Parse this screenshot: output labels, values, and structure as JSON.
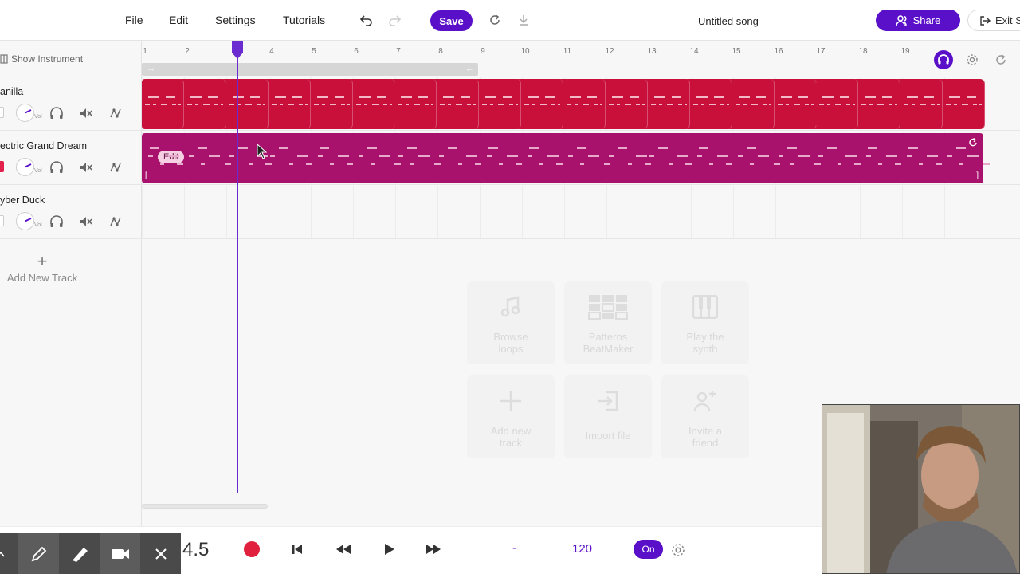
{
  "menu": {
    "file": "File",
    "edit": "Edit",
    "settings": "Settings",
    "tutorials": "Tutorials",
    "save": "Save"
  },
  "song_title": "Untitled song",
  "share_label": "Share",
  "exit_label": "Exit S",
  "left_panel": {
    "show_instrument": "Show Instrument",
    "add_new_track": "Add New Track",
    "vol_label": "Vol"
  },
  "tracks": [
    {
      "name": "anilla"
    },
    {
      "name": "ectric Grand Dream"
    },
    {
      "name": "yber Duck"
    }
  ],
  "ruler_ticks": [
    "1",
    "2",
    "4",
    "5",
    "6",
    "7",
    "8",
    "9",
    "10",
    "11",
    "12",
    "13",
    "14",
    "15",
    "16",
    "17",
    "18",
    "19"
  ],
  "clip_edit_label": "Edit",
  "tiles": [
    {
      "label1": "Browse",
      "label2": "loops"
    },
    {
      "label1": "Patterns",
      "label2": "BeatMaker"
    },
    {
      "label1": "Play the",
      "label2": "synth"
    },
    {
      "label1": "Add new",
      "label2": "track"
    },
    {
      "label1": "Import file",
      "label2": ""
    },
    {
      "label1": "Invite a",
      "label2": "friend"
    }
  ],
  "transport": {
    "position": "4.5",
    "time_signature_placeholder": "-",
    "bpm": "120",
    "metronome": "On"
  },
  "colors": {
    "accent": "#5a0fc8",
    "track1_clip": "#c8103a",
    "track2_clip": "#a8126c",
    "record": "#e0203c"
  },
  "playhead_bar": 3.1
}
